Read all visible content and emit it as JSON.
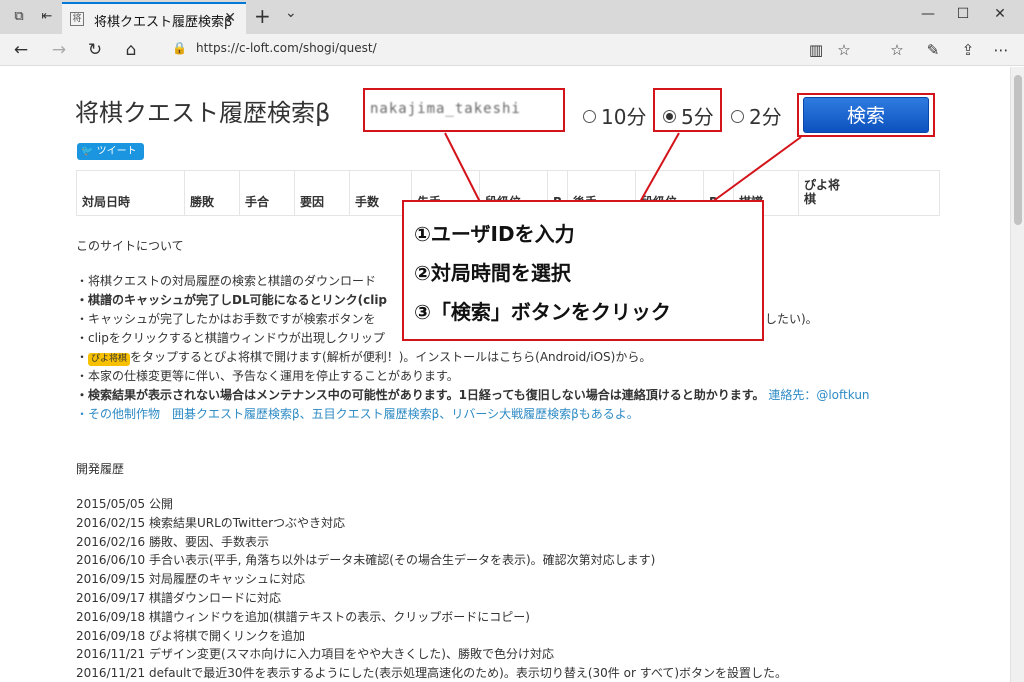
{
  "browser": {
    "tab_title": "将棋クエスト履歴検索β",
    "url": "https://c-loft.com/shogi/quest/",
    "lock_glyph": "🔒",
    "icons": [
      "tab-preview-icon",
      "tab-aside-icon",
      "close-icon",
      "plus-icon",
      "chevron-down-icon",
      "minimize-icon",
      "maximize-icon",
      "close-window-icon",
      "back-icon",
      "forward-icon",
      "refresh-icon",
      "home-icon",
      "reading-view-icon",
      "favorite-icon",
      "favorites-list-icon",
      "pen-icon",
      "share-icon",
      "more-icon"
    ]
  },
  "site": {
    "title": "将棋クエスト履歴検索β",
    "user_id_value": "nakajima_takeshi",
    "radio_10": "10分",
    "radio_5": "5分",
    "radio_2": "2分",
    "search_label": "検索",
    "tweet_label": "ツイート",
    "selected_radio": "5分"
  },
  "table_headers": [
    "対局日時",
    "勝敗",
    "手合",
    "要因",
    "手数",
    "先手",
    "段級位",
    "R",
    "後手",
    "段級位",
    "R",
    "棋譜",
    "ぴよ将棋"
  ],
  "about": {
    "heading": "このサイトについて",
    "lines": [
      "・将棋クエストの対局履歴の検索と棋譜のダウンロード",
      "・棋譜のキャッシュが完了しDL可能になるとリンク(clip",
      "・キャッシュが完了したかはお手数ですが検索ボタンを",
      "・clipをクリックすると棋譜ウィンドウが出現しクリップ",
      "をタップするとぴよ将棋で開けます(解析が便利！)。インストールはこちら(Android/iOS)から。",
      "・本家の仕様変更等に伴い、予告なく運用を停止することがあります。",
      "・検索結果が表示されない場合はメンテナンス中の可能性があります。1日経っても復旧しない場合は連絡頂けると助かります。",
      "連絡先：@loftkun",
      "・その他制作物　囲碁クエスト履歴検索β、五目クエスト履歴検索β、リバーシ大戦履歴検索βもあるよ。"
    ],
    "line3_tail": "したい)。",
    "piyo_badge": "ぴよ将棋"
  },
  "history": {
    "heading": "開発履歴",
    "items": [
      "2015/05/05 公開",
      "2016/02/15 検索結果URLのTwitterつぶやき対応",
      "2016/02/16 勝敗、要因、手数表示",
      "2016/06/10 手合い表示(平手, 角落ち以外はデータ未確認(その場合生データを表示)。確認次第対応します)",
      "2016/09/15 対局履歴のキャッシュに対応",
      "2016/09/17 棋譜ダウンロードに対応",
      "2016/09/18 棋譜ウィンドウを追加(棋譜テキストの表示、クリップボードにコピー)",
      "2016/09/18 ぴよ将棋で開くリンクを追加",
      "2016/11/21 デザイン変更(スマホ向けに入力項目をやや大きくした)、勝敗で色分け対応",
      "2016/11/21 defaultで最近30件を表示するようにした(表示処理高速化のため)。表示切り替え(30件 or すべて)ボタンを設置した。"
    ]
  },
  "callout": {
    "step1": "①ユーザIDを入力",
    "step2": "②対局時間を選択",
    "step3": "③「検索」ボタンをクリック"
  },
  "colors": {
    "annotation_red": "#d3141a",
    "search_blue": "#0d52bf",
    "link_blue": "#2e8bc5",
    "tweet_blue": "#1b95e0"
  }
}
